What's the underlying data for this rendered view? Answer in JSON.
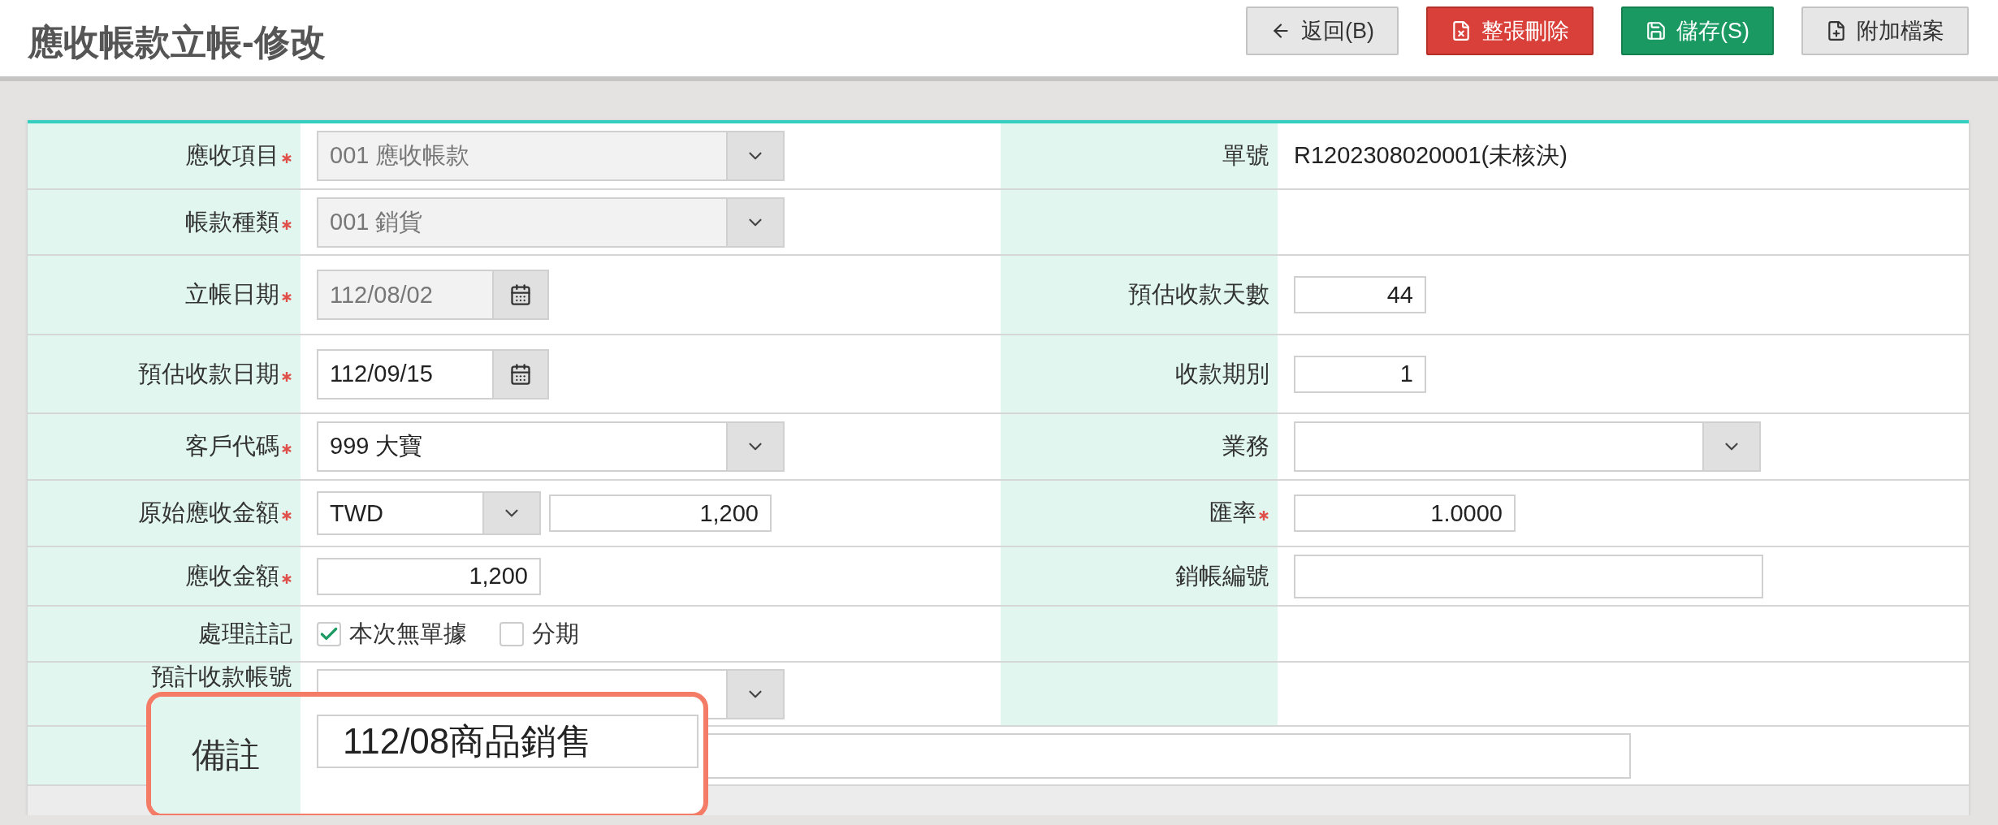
{
  "title": "應收帳款立帳-修改",
  "buttons": [
    {
      "label": "返回(B)",
      "kind": "back"
    },
    {
      "label": "整張刪除",
      "kind": "delete"
    },
    {
      "label": "儲存(S)",
      "kind": "save"
    },
    {
      "label": "附加檔案",
      "kind": "attach"
    }
  ],
  "rows": [
    {
      "left": {
        "label": "應收項目",
        "required": true,
        "control": {
          "kind": "select",
          "value": "001 應收帳款",
          "disabled": true
        }
      },
      "right": {
        "label": "單號",
        "control": {
          "kind": "text",
          "value": "R1202308020001(未核決)"
        }
      }
    },
    {
      "left": {
        "label": "帳款種類",
        "required": true,
        "control": {
          "kind": "select",
          "value": "001 銷貨",
          "disabled": true
        }
      }
    },
    {
      "left": {
        "label": "立帳日期",
        "required": true,
        "control": {
          "kind": "date",
          "value": "112/08/02",
          "disabled": true
        }
      },
      "right": {
        "label": "預估收款天數",
        "control": {
          "kind": "number",
          "value": "44"
        }
      }
    },
    {
      "left": {
        "label": "預估收款日期",
        "required": true,
        "control": {
          "kind": "date",
          "value": "112/09/15"
        }
      },
      "right": {
        "label": "收款期別",
        "control": {
          "kind": "number",
          "value": "1"
        }
      }
    },
    {
      "left": {
        "label": "客戶代碼",
        "required": true,
        "control": {
          "kind": "select",
          "value": "999 大寶"
        }
      },
      "right": {
        "label": "業務",
        "control": {
          "kind": "select"
        }
      }
    },
    {
      "left": {
        "label": "原始應收金額",
        "required": true,
        "control": {
          "kind": "currency",
          "currency": "TWD",
          "value": "1,200"
        }
      },
      "right": {
        "label": "匯率",
        "required": true,
        "control": {
          "kind": "number",
          "value": "1.0000"
        }
      }
    },
    {
      "left": {
        "label": "應收金額",
        "required": true,
        "control": {
          "kind": "number",
          "value": "1,200"
        }
      },
      "right": {
        "label": "銷帳編號",
        "control": {
          "kind": "input"
        }
      }
    },
    {
      "left": {
        "label": "處理註記",
        "control": {
          "kind": "checkboxes",
          "options": [
            {
              "label": "本次無單據",
              "checked": true
            },
            {
              "label": "分期",
              "checked": false
            }
          ]
        }
      }
    },
    {
      "left": {
        "label": "預計收款帳號",
        "control": {
          "kind": "select"
        }
      }
    },
    {
      "wide": {
        "control": {
          "kind": "input"
        }
      }
    }
  ],
  "callout": {
    "label": "備註",
    "value": "112/08商品銷售"
  }
}
